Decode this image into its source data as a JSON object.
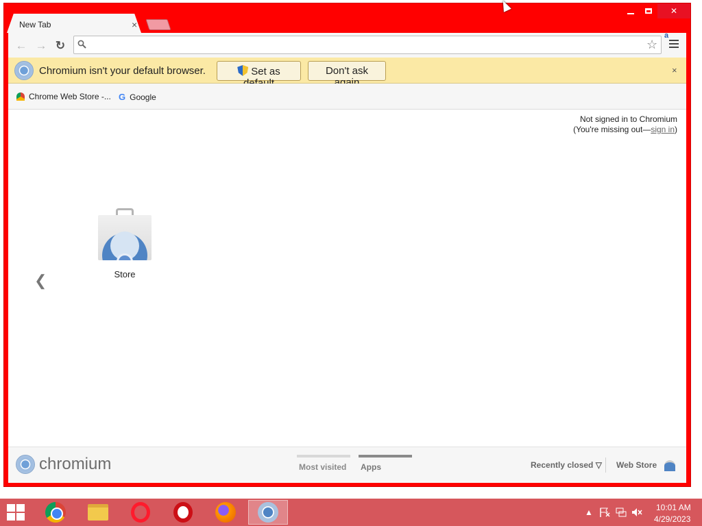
{
  "window": {
    "controls": [
      "minimize",
      "maximize",
      "close"
    ],
    "close_glyph": "✕"
  },
  "tabs": [
    {
      "title": "New Tab",
      "close": "×"
    }
  ],
  "toolbar": {
    "back": "←",
    "forward": "→",
    "reload": "↻",
    "omnibox_value": "",
    "search_glyph": "🔍",
    "star_glyph": "☆",
    "extension_label": "a"
  },
  "infobar": {
    "message": "Chromium isn't your default browser.",
    "set_default": "Set as default",
    "dont_ask": "Don't ask again",
    "close": "×"
  },
  "bookmarks": [
    {
      "label": "Chrome Web Store -..."
    },
    {
      "label": "Google",
      "icon_text": "G"
    }
  ],
  "signin": {
    "line1": "Not signed in to Chromium",
    "line2_prefix": "(You're missing out—",
    "link": "sign in",
    "line2_suffix": ")"
  },
  "apps": [
    {
      "label": "Store"
    }
  ],
  "pager": {
    "left": "❮"
  },
  "footer": {
    "brand": "chromium",
    "tabs": [
      {
        "label": "Most visited",
        "selected": false
      },
      {
        "label": "Apps",
        "selected": true
      }
    ],
    "recently_closed": "Recently closed ▽",
    "web_store": "Web Store"
  },
  "taskbar": {
    "apps": [
      "chrome",
      "file-explorer",
      "opera",
      "opera-gx",
      "firefox",
      "chromium"
    ],
    "active": "chromium",
    "tray_arrow": "▲",
    "time": "10:01 AM",
    "date": "4/29/2023"
  },
  "colors": {
    "frame": "#ff0000",
    "infobar": "#fbe9a5",
    "taskbar": "#d6575c",
    "tab_selected_bar": "#8a8a8a",
    "tab_unselected_bar": "#d8d8d8"
  }
}
